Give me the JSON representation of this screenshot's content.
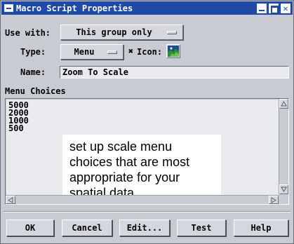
{
  "window": {
    "title": "Macro Script Properties",
    "controls": [
      "minimize-icon",
      "maximize-icon",
      "close-icon"
    ],
    "close_glyph": "✕"
  },
  "use_with": {
    "label": "Use with:",
    "value": "This group only"
  },
  "type": {
    "label": "Type:",
    "value": "Menu"
  },
  "icon": {
    "checkbox_glyph": "✖",
    "checked": true,
    "label": "Icon:"
  },
  "name": {
    "label": "Name:",
    "value": "Zoom To Scale"
  },
  "menu_choices": {
    "label": "Menu Choices",
    "items": [
      "5000",
      "2000",
      "1000",
      "500"
    ]
  },
  "annotation": {
    "text": "set up scale menu choices that are most appropriate for your spatial data."
  },
  "buttons": {
    "ok": "OK",
    "cancel": "Cancel",
    "edit": "Edit...",
    "test": "Test",
    "help": "Help"
  },
  "colors": {
    "titlebar": "#1f4aa8",
    "dialog_bg": "#c8ccd2",
    "field_bg": "#e8eaed"
  }
}
